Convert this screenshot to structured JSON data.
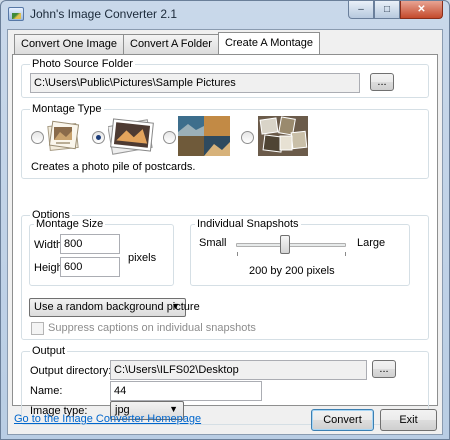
{
  "window": {
    "title": "John's Image Converter 2.1",
    "minimize_glyph": "–",
    "maximize_glyph": "□",
    "close_glyph": "✕"
  },
  "tabs": [
    {
      "label": "Convert One Image",
      "active": false
    },
    {
      "label": "Convert A Folder",
      "active": false
    },
    {
      "label": "Create A Montage",
      "active": true
    }
  ],
  "photo_source": {
    "legend": "Photo Source Folder",
    "path": "C:\\Users\\Public\\Pictures\\Sample Pictures",
    "browse_label": "..."
  },
  "montage_type": {
    "legend": "Montage Type",
    "options": [
      {
        "name": "pile-of-postcards",
        "checked": false
      },
      {
        "name": "pile-of-photos",
        "checked": true
      },
      {
        "name": "grid-of-photos",
        "checked": false
      },
      {
        "name": "collage",
        "checked": false
      }
    ],
    "description": "Creates a photo pile of postcards."
  },
  "options": {
    "legend": "Options",
    "montage_size": {
      "legend": "Montage Size",
      "width_label": "Width:",
      "width_value": "800",
      "height_label": "Height:",
      "height_value": "600",
      "unit": "pixels"
    },
    "snapshots": {
      "legend": "Individual Snapshots",
      "small_label": "Small",
      "large_label": "Large",
      "size_text": "200 by 200 pixels",
      "slider_fraction": 0.45
    },
    "background_select": "Use a random background picture",
    "suppress_captions_label": "Suppress captions on individual snapshots",
    "suppress_captions_checked": false
  },
  "output": {
    "legend": "Output",
    "directory_label": "Output directory:",
    "directory_value": "C:\\Users\\ILFS02\\Desktop",
    "browse_label": "...",
    "name_label": "Name:",
    "name_value": "44",
    "image_type_label": "Image type:",
    "image_type_value": "jpg"
  },
  "footer": {
    "homepage_link": "Go to the Image Converter Homepage",
    "convert_label": "Convert",
    "exit_label": "Exit"
  },
  "colors": {
    "link": "#0066cc",
    "group_border": "#d5dfe5",
    "window_frame": "#b9cde4"
  }
}
